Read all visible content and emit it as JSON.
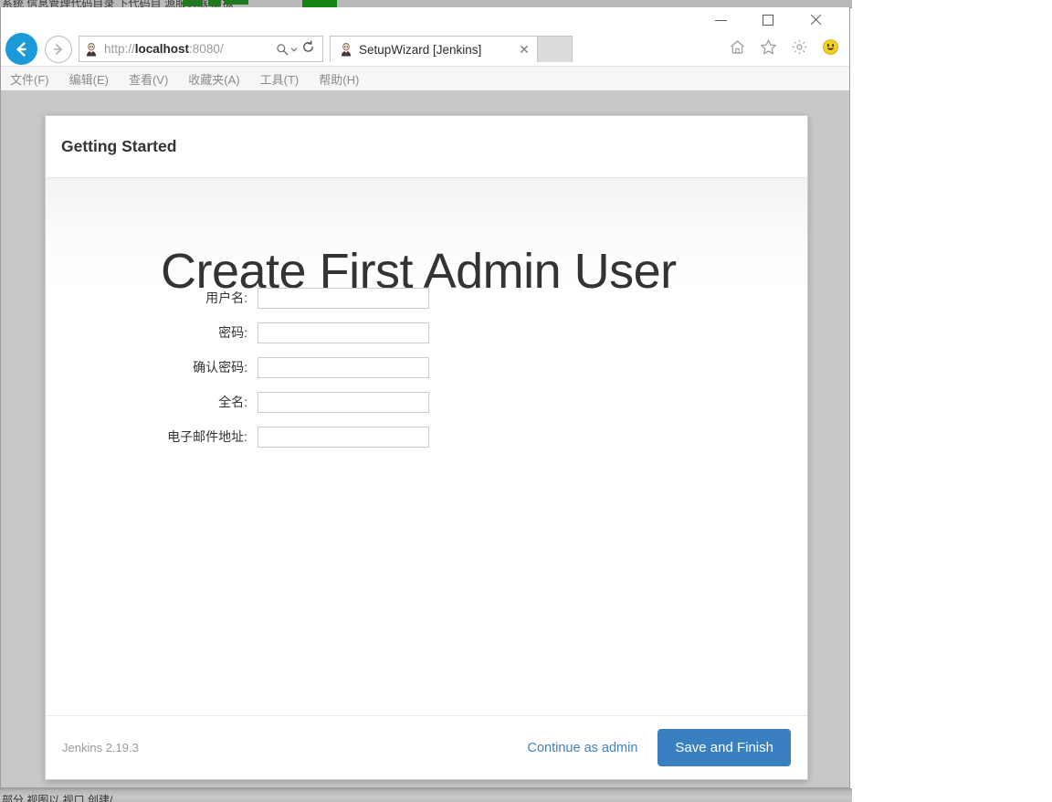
{
  "background": {
    "top_sliver_text": "系统 信息管理代码目录  下代码目 源服务器 虚拟",
    "bottom_sliver_text": "部分 视图以 视口 创建/"
  },
  "browser": {
    "window_controls": {
      "minimize": "minimize-icon",
      "maximize": "maximize-icon",
      "close": "close-icon"
    },
    "back_icon": "back-arrow-icon",
    "forward_icon": "forward-arrow-icon",
    "address": {
      "favicon": "jenkins-butler-favicon",
      "url_scheme": "http://",
      "url_host": "localhost",
      "url_rest": ":8080/",
      "url_full": "http://localhost:8080/",
      "search_icon": "search-icon",
      "dropdown_icon": "chevron-down-icon",
      "refresh_icon": "refresh-icon"
    },
    "tab": {
      "favicon": "jenkins-butler-favicon",
      "title": "SetupWizard [Jenkins]",
      "close_icon": "close-icon",
      "new_tab_icon": "new-tab-icon"
    },
    "toolbar_icons": [
      {
        "name": "home-icon",
        "glyph": "⌂"
      },
      {
        "name": "favorites-star-icon",
        "glyph": "☆"
      },
      {
        "name": "settings-gear-icon",
        "glyph": "⚙"
      },
      {
        "name": "smiley-feedback-icon",
        "glyph": "☺"
      }
    ],
    "menu": [
      {
        "name": "menu-file",
        "label": "文件(F)"
      },
      {
        "name": "menu-edit",
        "label": "编辑(E)"
      },
      {
        "name": "menu-view",
        "label": "查看(V)"
      },
      {
        "name": "menu-favorites",
        "label": "收藏夹(A)"
      },
      {
        "name": "menu-tools",
        "label": "工具(T)"
      },
      {
        "name": "menu-help",
        "label": "帮助(H)"
      }
    ]
  },
  "page": {
    "card_header_title": "Getting Started",
    "heading": "Create First Admin User",
    "form": {
      "fields": [
        {
          "name": "username",
          "label": "用户名:",
          "value": "",
          "type": "text"
        },
        {
          "name": "password",
          "label": "密码:",
          "value": "",
          "type": "password"
        },
        {
          "name": "confirm-password",
          "label": "确认密码:",
          "value": "",
          "type": "password"
        },
        {
          "name": "fullname",
          "label": "全名:",
          "value": "",
          "type": "text"
        },
        {
          "name": "email",
          "label": "电子邮件地址:",
          "value": "",
          "type": "text"
        }
      ]
    },
    "footer": {
      "version": "Jenkins 2.19.3",
      "continue_link": "Continue as admin",
      "primary_button": "Save and Finish"
    }
  },
  "colors": {
    "primary_button": "#3a80c1",
    "link": "#3f82bd",
    "page_background": "#c8c8c8",
    "card_background": "#ffffff",
    "back_button": "#1a9ad7"
  }
}
